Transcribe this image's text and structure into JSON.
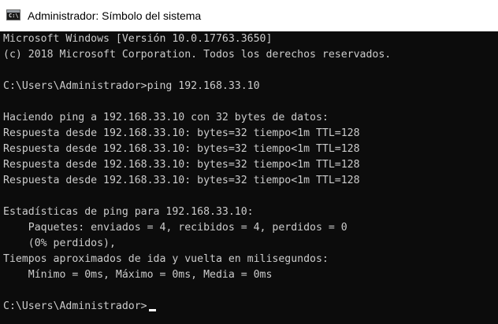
{
  "window": {
    "title": "Administrador: Símbolo del sistema",
    "icon": "console-icon",
    "icon_glyph": "C:\\"
  },
  "console": {
    "lines": [
      "Microsoft Windows [Versión 10.0.17763.3650]",
      "(c) 2018 Microsoft Corporation. Todos los derechos reservados.",
      "",
      "C:\\Users\\Administrador>ping 192.168.33.10",
      "",
      "Haciendo ping a 192.168.33.10 con 32 bytes de datos:",
      "Respuesta desde 192.168.33.10: bytes=32 tiempo<1m TTL=128",
      "Respuesta desde 192.168.33.10: bytes=32 tiempo<1m TTL=128",
      "Respuesta desde 192.168.33.10: bytes=32 tiempo<1m TTL=128",
      "Respuesta desde 192.168.33.10: bytes=32 tiempo<1m TTL=128",
      "",
      "Estadísticas de ping para 192.168.33.10:",
      "    Paquetes: enviados = 4, recibidos = 4, perdidos = 0",
      "    (0% perdidos),",
      "Tiempos aproximados de ida y vuelta en milisegundos:",
      "    Mínimo = 0ms, Máximo = 0ms, Media = 0ms",
      "",
      "C:\\Users\\Administrador>"
    ],
    "text_color": "#cccccc",
    "background": "#0c0c0c"
  }
}
